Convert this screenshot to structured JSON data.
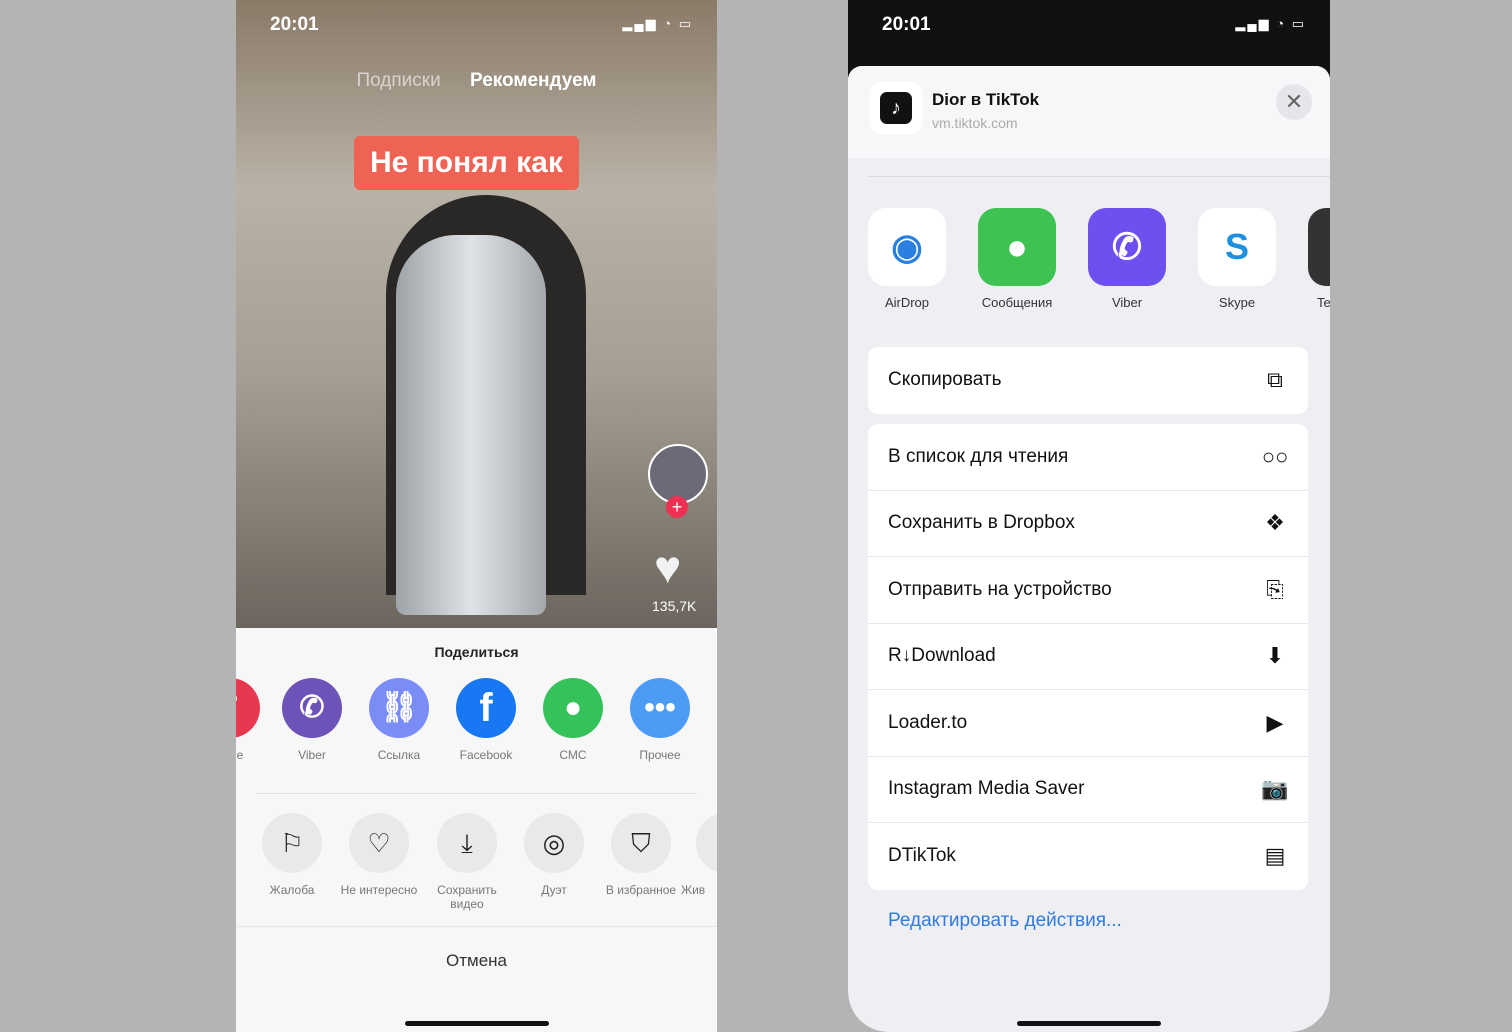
{
  "left": {
    "time": "20:01",
    "tabs": [
      "Подписки",
      "Рекомендуем"
    ],
    "caption": "Не понял как",
    "likes": "135,7K",
    "sheet_title": "Поделиться",
    "share_items": [
      {
        "label": "ение",
        "icon": "partial-icon",
        "color": "#e8384f"
      },
      {
        "label": "Viber",
        "icon": "viber-icon",
        "color": "#7360f2"
      },
      {
        "label": "Ссылка",
        "icon": "link-icon",
        "color": "#7a8cf5"
      },
      {
        "label": "Facebook",
        "icon": "facebook-icon",
        "color": "#1877f2"
      },
      {
        "label": "СМС",
        "icon": "sms-icon",
        "color": "#35c25b"
      },
      {
        "label": "Прочее",
        "icon": "more-icon",
        "color": "#4c9bf5"
      }
    ],
    "actions": [
      {
        "label": "Жалоба",
        "icon": "flag-icon"
      },
      {
        "label": "Не интересно",
        "icon": "broken-heart-icon"
      },
      {
        "label": "Сохранить видео",
        "icon": "download-icon"
      },
      {
        "label": "Дуэт",
        "icon": "duet-icon"
      },
      {
        "label": "В избранное",
        "icon": "bookmark-icon"
      },
      {
        "label": "Жив",
        "icon": "live-icon"
      }
    ],
    "cancel": "Отмена"
  },
  "right": {
    "time": "20:01",
    "title": "Dior в TikTok",
    "subtitle": "vm.tiktok.com",
    "apps": [
      {
        "label": "AirDrop",
        "icon": "airdrop-icon"
      },
      {
        "label": "Сообщения",
        "icon": "messages-icon"
      },
      {
        "label": "Viber",
        "icon": "viber-icon"
      },
      {
        "label": "Skype",
        "icon": "skype-icon"
      },
      {
        "label": "Te",
        "icon": "telegram-icon"
      }
    ],
    "copy": "Скопировать",
    "actions": [
      {
        "label": "В список для чтения",
        "icon": "glasses-icon"
      },
      {
        "label": "Сохранить в Dropbox",
        "icon": "dropbox-icon"
      },
      {
        "label": "Отправить на устройство",
        "icon": "send-device-icon"
      },
      {
        "label": "R↓Download",
        "icon": "download-box-icon"
      },
      {
        "label": "Loader.to",
        "icon": "play-icon"
      },
      {
        "label": "Instagram Media Saver",
        "icon": "camera-icon"
      },
      {
        "label": "DTikTok",
        "icon": "film-icon"
      }
    ],
    "edit": "Редактировать действия..."
  }
}
